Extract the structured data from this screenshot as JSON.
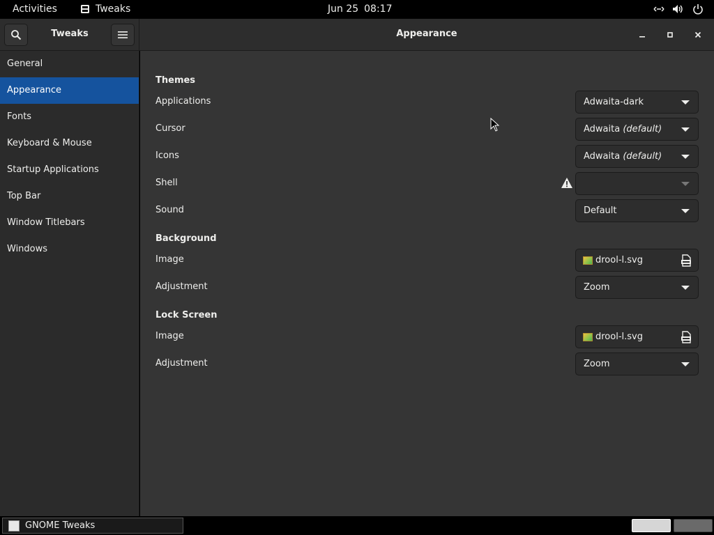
{
  "topbar": {
    "activities": "Activities",
    "app_name": "Tweaks",
    "date": "Jun 25",
    "time": "08:17"
  },
  "headerbar": {
    "left_title": "Tweaks",
    "main_title": "Appearance"
  },
  "sidebar": {
    "items": [
      {
        "label": "General"
      },
      {
        "label": "Appearance"
      },
      {
        "label": "Fonts"
      },
      {
        "label": "Keyboard & Mouse"
      },
      {
        "label": "Startup Applications"
      },
      {
        "label": "Top Bar"
      },
      {
        "label": "Window Titlebars"
      },
      {
        "label": "Windows"
      }
    ],
    "active_index": 1
  },
  "main": {
    "themes": {
      "title": "Themes",
      "applications": {
        "label": "Applications",
        "value": "Adwaita-dark"
      },
      "cursor": {
        "label": "Cursor",
        "value": "Adwaita",
        "suffix": "(default)"
      },
      "icons": {
        "label": "Icons",
        "value": "Adwaita",
        "suffix": "(default)"
      },
      "shell": {
        "label": "Shell",
        "value": ""
      },
      "sound": {
        "label": "Sound",
        "value": "Default"
      }
    },
    "background": {
      "title": "Background",
      "image": {
        "label": "Image",
        "value": "drool-l.svg"
      },
      "adjustment": {
        "label": "Adjustment",
        "value": "Zoom"
      }
    },
    "lock_screen": {
      "title": "Lock Screen",
      "image": {
        "label": "Image",
        "value": "drool-l.svg"
      },
      "adjustment": {
        "label": "Adjustment",
        "value": "Zoom"
      }
    }
  },
  "bottombar": {
    "task_label": "GNOME Tweaks"
  },
  "colors": {
    "accent": "#15539e",
    "sidebar_bg": "#2b2b2b",
    "main_bg": "#353535",
    "headerbar_bg": "#2d2d2d"
  }
}
